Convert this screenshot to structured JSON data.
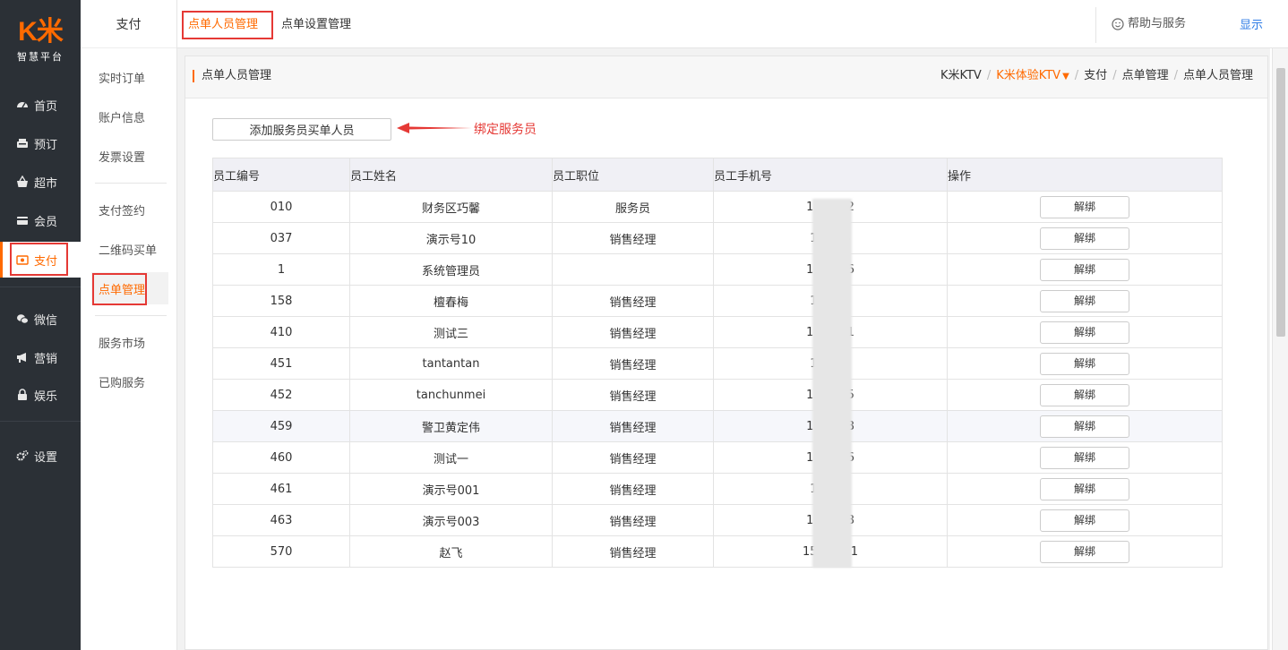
{
  "logo": {
    "mark": "K米",
    "subtitle": "智慧平台"
  },
  "nav": {
    "items": [
      {
        "label": "首页",
        "icon": "dashboard-icon"
      },
      {
        "label": "预订",
        "icon": "booking-icon"
      },
      {
        "label": "超市",
        "icon": "basket-icon"
      },
      {
        "label": "会员",
        "icon": "card-icon"
      },
      {
        "label": "支付",
        "icon": "payment-icon",
        "active": true
      },
      {
        "label": "微信",
        "icon": "wechat-icon"
      },
      {
        "label": "营销",
        "icon": "megaphone-icon"
      },
      {
        "label": "娱乐",
        "icon": "lock-icon"
      },
      {
        "label": "设置",
        "icon": "gear-icon"
      }
    ]
  },
  "side": {
    "title": "支付",
    "items": [
      "实时订单",
      "账户信息",
      "发票设置",
      "支付签约",
      "二维码买单",
      "点单管理",
      "服务市场",
      "已购服务"
    ]
  },
  "topbar": {
    "tabs": [
      "点单人员管理",
      "点单设置管理"
    ],
    "help": "帮助与服务",
    "display": "显示"
  },
  "breadcrumb": {
    "page_title": "点单人员管理",
    "items": [
      "K米KTV",
      "K米体验KTV",
      "支付",
      "点单管理",
      "点单人员管理"
    ]
  },
  "toolbar": {
    "add_label": "添加服务员买单人员",
    "annotation": "绑定服务员"
  },
  "table": {
    "headers": [
      "员工编号",
      "员工姓名",
      "员工职位",
      "员工手机号",
      "操作"
    ],
    "action_label": "解绑",
    "rows": [
      {
        "id": "010",
        "name": "财务区巧馨",
        "position": "服务员",
        "phone": "183     822"
      },
      {
        "id": "037",
        "name": "演示号10",
        "position": "销售经理",
        "phone": "183     26"
      },
      {
        "id": "1",
        "name": "系统管理员",
        "position": "",
        "phone": "186     096"
      },
      {
        "id": "158",
        "name": "檀春梅",
        "position": "销售经理",
        "phone": "186     85"
      },
      {
        "id": "410",
        "name": "测试三",
        "position": "销售经理",
        "phone": "185     511"
      },
      {
        "id": "451",
        "name": "tantantan",
        "position": "销售经理",
        "phone": "183     25"
      },
      {
        "id": "452",
        "name": "tanchunmei",
        "position": "销售经理",
        "phone": "183     555"
      },
      {
        "id": "459",
        "name": "警卫黄定伟",
        "position": "销售经理",
        "phone": "185     618"
      },
      {
        "id": "460",
        "name": "测试一",
        "position": "销售经理",
        "phone": "150     436"
      },
      {
        "id": "461",
        "name": "演示号001",
        "position": "销售经理",
        "phone": "15      595"
      },
      {
        "id": "463",
        "name": "演示号003",
        "position": "销售经理",
        "phone": "139     608"
      },
      {
        "id": "570",
        "name": "赵飞",
        "position": "销售经理",
        "phone": "157     3671"
      }
    ]
  },
  "colors": {
    "accent": "#ff6a00",
    "nav_bg": "#2b3036",
    "annotation": "#e53935",
    "link": "#2c7be5"
  }
}
